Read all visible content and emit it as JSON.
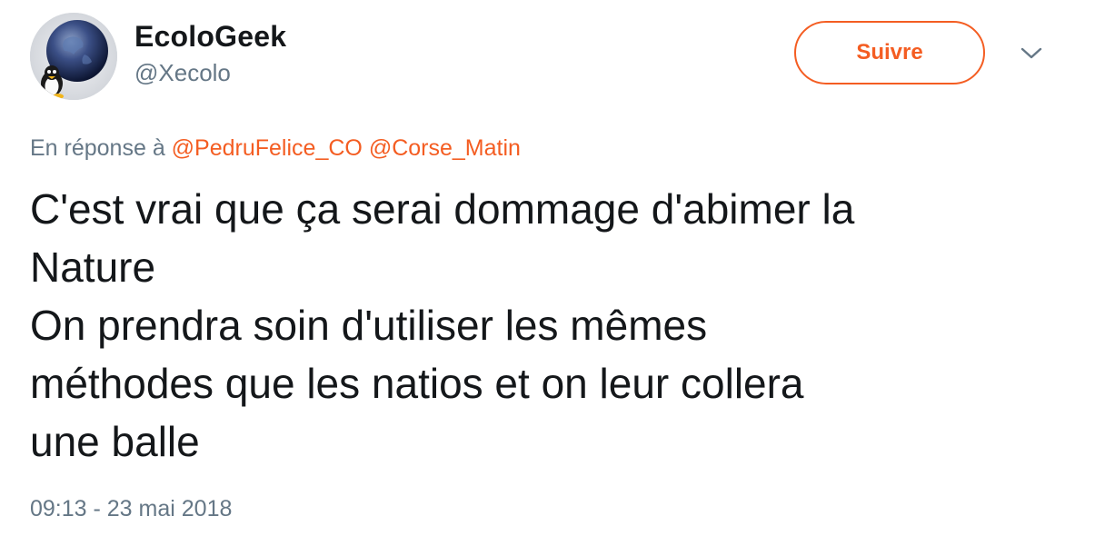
{
  "author": {
    "display_name": "EcoloGeek",
    "handle": "@Xecolo",
    "avatar_icon": "globe-penguin-avatar"
  },
  "follow_button": {
    "label": "Suivre"
  },
  "menu": {
    "icon": "chevron-down-icon"
  },
  "reply": {
    "prefix": "En réponse à",
    "mentions": [
      "@PedruFelice_CO",
      "@Corse_Matin"
    ]
  },
  "tweet": {
    "lines": [
      "C'est vrai que ça serai dommage d'abimer la",
      "Nature",
      "On prendra soin d'utiliser les mêmes",
      "méthodes que les natios et on leur collera",
      "une balle"
    ]
  },
  "timestamp": "09:13 - 23 mai 2018",
  "colors": {
    "accent": "#f45d22",
    "text": "#14171a",
    "secondary": "#657786"
  }
}
